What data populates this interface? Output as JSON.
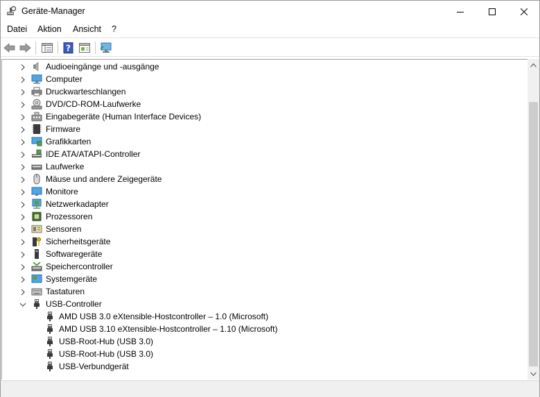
{
  "window": {
    "title": "Geräte-Manager",
    "controls": {
      "minimize": "minimize",
      "maximize": "maximize",
      "close": "close"
    }
  },
  "menu": {
    "items": [
      "Datei",
      "Aktion",
      "Ansicht",
      "?"
    ]
  },
  "toolbar": {
    "buttons": [
      "back-icon",
      "forward-icon",
      "properties-view-icon",
      "help-icon",
      "update-driver-icon",
      "monitor-scan-icon"
    ]
  },
  "tree": {
    "categories": [
      {
        "label": "Audioeingänge und -ausgänge",
        "icon": "speaker-icon",
        "expanded": false
      },
      {
        "label": "Computer",
        "icon": "computer-icon",
        "expanded": false
      },
      {
        "label": "Druckwarteschlangen",
        "icon": "printer-icon",
        "expanded": false
      },
      {
        "label": "DVD/CD-ROM-Laufwerke",
        "icon": "disc-drive-icon",
        "expanded": false
      },
      {
        "label": "Eingabegeräte (Human Interface Devices)",
        "icon": "hid-icon",
        "expanded": false
      },
      {
        "label": "Firmware",
        "icon": "firmware-chip-icon",
        "expanded": false
      },
      {
        "label": "Grafikkarten",
        "icon": "display-adapter-icon",
        "expanded": false
      },
      {
        "label": "IDE ATA/ATAPI-Controller",
        "icon": "ide-controller-icon",
        "expanded": false
      },
      {
        "label": "Laufwerke",
        "icon": "disk-drive-icon",
        "expanded": false
      },
      {
        "label": "Mäuse und andere Zeigegeräte",
        "icon": "mouse-icon",
        "expanded": false
      },
      {
        "label": "Monitore",
        "icon": "monitor-icon",
        "expanded": false
      },
      {
        "label": "Netzwerkadapter",
        "icon": "network-adapter-icon",
        "expanded": false
      },
      {
        "label": "Prozessoren",
        "icon": "processor-icon",
        "expanded": false
      },
      {
        "label": "Sensoren",
        "icon": "sensor-icon",
        "expanded": false
      },
      {
        "label": "Sicherheitsgeräte",
        "icon": "security-device-icon",
        "expanded": false
      },
      {
        "label": "Softwaregeräte",
        "icon": "software-device-icon",
        "expanded": false
      },
      {
        "label": "Speichercontroller",
        "icon": "storage-controller-icon",
        "expanded": false
      },
      {
        "label": "Systemgeräte",
        "icon": "system-device-icon",
        "expanded": false
      },
      {
        "label": "Tastaturen",
        "icon": "keyboard-icon",
        "expanded": false
      },
      {
        "label": "USB-Controller",
        "icon": "usb-icon",
        "expanded": true
      }
    ],
    "usb_children": [
      {
        "label": "AMD USB 3.0 eXtensible-Hostcontroller – 1.0 (Microsoft)",
        "icon": "usb-icon"
      },
      {
        "label": "AMD USB 3.10 eXtensible-Hostcontroller – 1.10 (Microsoft)",
        "icon": "usb-icon"
      },
      {
        "label": "USB-Root-Hub (USB 3.0)",
        "icon": "usb-icon"
      },
      {
        "label": "USB-Root-Hub (USB 3.0)",
        "icon": "usb-icon"
      },
      {
        "label": "USB-Verbundgerät",
        "icon": "usb-icon"
      }
    ]
  },
  "colors": {
    "accent": "#1e6fbf",
    "scrollbar_thumb": "#cdcdcd",
    "status_bg": "#f0f0f0"
  }
}
